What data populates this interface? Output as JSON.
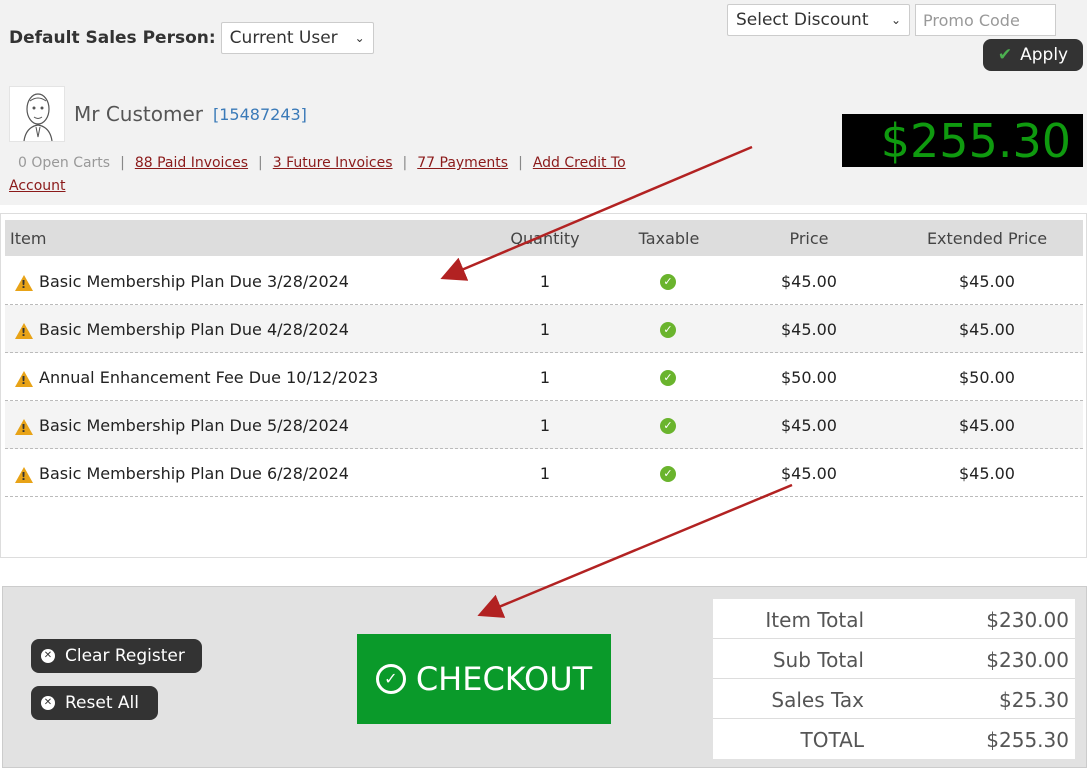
{
  "header": {
    "sales_person_label": "Default Sales Person:",
    "sales_person_value": "Current User",
    "discount_select": "Select Discount",
    "promo_placeholder": "Promo Code",
    "apply_label": "Apply"
  },
  "customer": {
    "name": "Mr Customer",
    "id": "[15487243]",
    "open_carts": "0 Open Carts",
    "paid_invoices": "88 Paid Invoices",
    "future_invoices": "3 Future Invoices",
    "payments": "77 Payments",
    "add_credit": "Add Credit To Account"
  },
  "big_total": "$255.30",
  "table": {
    "headers": [
      "Item",
      "Quantity",
      "Taxable",
      "Price",
      "Extended Price"
    ],
    "rows": [
      {
        "item": "Basic Membership Plan Due 3/28/2024",
        "quantity": "1",
        "price": "$45.00",
        "extended": "$45.00"
      },
      {
        "item": "Basic Membership Plan Due 4/28/2024",
        "quantity": "1",
        "price": "$45.00",
        "extended": "$45.00"
      },
      {
        "item": "Annual Enhancement Fee Due 10/12/2023",
        "quantity": "1",
        "price": "$50.00",
        "extended": "$50.00"
      },
      {
        "item": "Basic Membership Plan Due 5/28/2024",
        "quantity": "1",
        "price": "$45.00",
        "extended": "$45.00"
      },
      {
        "item": "Basic Membership Plan Due 6/28/2024",
        "quantity": "1",
        "price": "$45.00",
        "extended": "$45.00"
      }
    ]
  },
  "actions": {
    "clear_register": "Clear Register",
    "reset_all": "Reset All",
    "checkout": "CHECKOUT"
  },
  "totals": [
    {
      "label": "Item Total",
      "value": "$230.00"
    },
    {
      "label": "Sub Total",
      "value": "$230.00"
    },
    {
      "label": "Sales Tax",
      "value": "$25.30"
    },
    {
      "label": "TOTAL",
      "value": "$255.30"
    }
  ],
  "colors": {
    "checkout_green": "#0a9a2a",
    "total_display_green": "#0f9a0f",
    "link_red": "#8b1a1a",
    "annotation_arrow": "#b22222"
  }
}
